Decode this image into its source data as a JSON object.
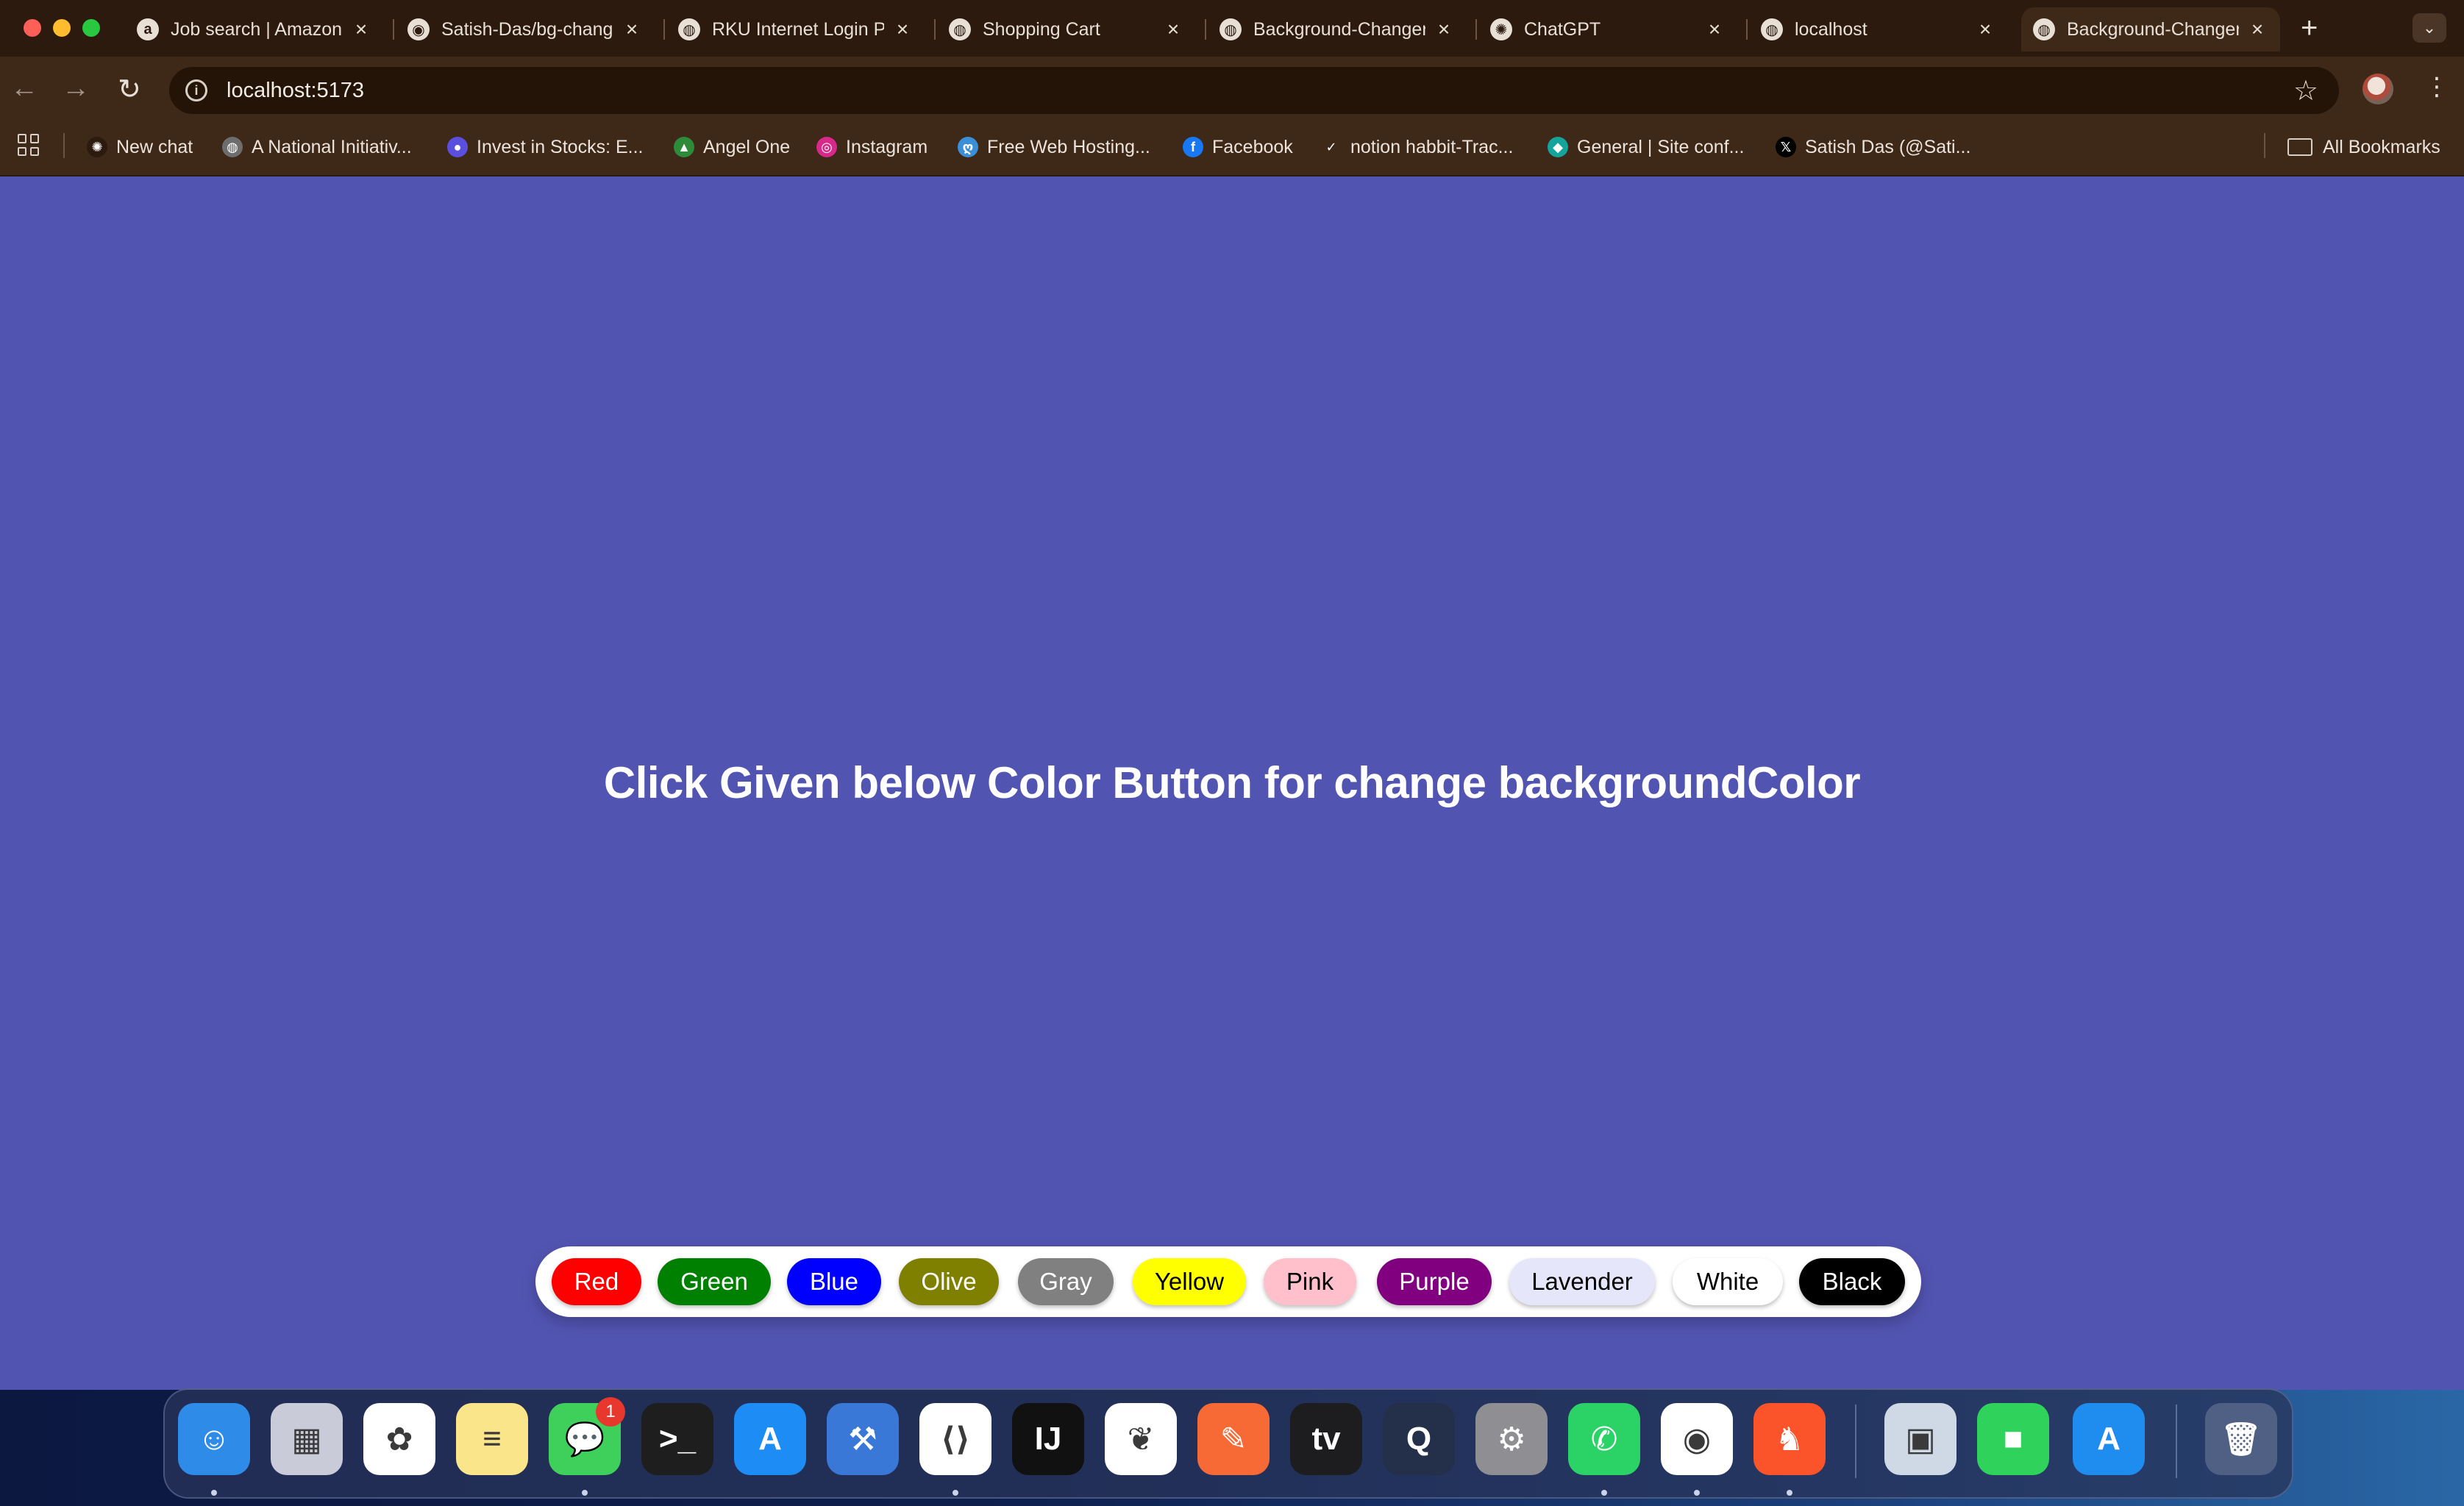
{
  "browser": {
    "tabs": [
      {
        "title": "Job search | Amazon",
        "icon": "amazon-icon",
        "fav": "a"
      },
      {
        "title": "Satish-Das/bg-changer",
        "icon": "github-icon",
        "fav": "◉"
      },
      {
        "title": "RKU Internet Login Page",
        "icon": "globe-icon",
        "fav": "◍"
      },
      {
        "title": "Shopping Cart",
        "icon": "globe-icon",
        "fav": "◍"
      },
      {
        "title": "Background-Changer",
        "icon": "globe-icon",
        "fav": "◍"
      },
      {
        "title": "ChatGPT",
        "icon": "chatgpt-icon",
        "fav": "✺"
      },
      {
        "title": "localhost",
        "icon": "globe-icon",
        "fav": "◍"
      },
      {
        "title": "Background-Changer",
        "icon": "globe-icon",
        "fav": "◍",
        "active": true
      }
    ],
    "close_glyph": "×",
    "new_tab_glyph": "+",
    "url": "localhost:5173",
    "bookmarks": [
      {
        "label": "New chat",
        "icon": "chatgpt-icon",
        "glyph": "✺",
        "color": "#2c1a0f"
      },
      {
        "label": "A National Initiativ...",
        "icon": "globe-icon",
        "glyph": "◍",
        "color": "#6d6d6d"
      },
      {
        "label": "Invest in Stocks: E...",
        "icon": "groww-icon",
        "glyph": "●",
        "color": "#5b4fe0"
      },
      {
        "label": "Angel One",
        "icon": "angel-one-icon",
        "glyph": "▲",
        "color": "#2e8b3a"
      },
      {
        "label": "Instagram",
        "icon": "instagram-icon",
        "glyph": "◎",
        "color": "#d6298a"
      },
      {
        "label": "Free Web Hosting...",
        "icon": "hosting-icon",
        "glyph": "ღ",
        "color": "#3a8fd6"
      },
      {
        "label": "Facebook",
        "icon": "facebook-icon",
        "glyph": "f",
        "color": "#1877f2"
      },
      {
        "label": "notion habbit-Trac...",
        "icon": "checkmark-icon",
        "glyph": "✓",
        "color": "#3e2818"
      },
      {
        "label": "General | Site conf...",
        "icon": "netlify-icon",
        "glyph": "◆",
        "color": "#15a49b"
      },
      {
        "label": "Satish Das (@Sati...",
        "icon": "x-icon",
        "glyph": "𝕏",
        "color": "#000000"
      }
    ],
    "all_bookmarks_label": "All Bookmarks"
  },
  "page": {
    "background": "#5254b2",
    "heading": "Click Given below Color Button for change backgroundColor",
    "buttons": [
      {
        "label": "Red",
        "bg": "#ff0000",
        "fg": "#ffffff"
      },
      {
        "label": "Green",
        "bg": "#008000",
        "fg": "#ffffff"
      },
      {
        "label": "Blue",
        "bg": "#0000ff",
        "fg": "#ffffff"
      },
      {
        "label": "Olive",
        "bg": "#808000",
        "fg": "#ffffff"
      },
      {
        "label": "Gray",
        "bg": "#808080",
        "fg": "#ffffff"
      },
      {
        "label": "Yellow",
        "bg": "#ffff00",
        "fg": "#000000"
      },
      {
        "label": "Pink",
        "bg": "#ffc0cb",
        "fg": "#000000"
      },
      {
        "label": "Purple",
        "bg": "#800080",
        "fg": "#ffffff"
      },
      {
        "label": "Lavender",
        "bg": "#e6e6fa",
        "fg": "#000000"
      },
      {
        "label": "White",
        "bg": "#ffffff",
        "fg": "#000000"
      },
      {
        "label": "Black",
        "bg": "#000000",
        "fg": "#ffffff"
      }
    ]
  },
  "dock": {
    "messages_badge": "1",
    "apps": [
      {
        "name": "finder-icon",
        "glyph": "☺",
        "bg": "#2f8be8",
        "dot": true
      },
      {
        "name": "launchpad-icon",
        "glyph": "▦",
        "bg": "#c9ccd8",
        "dot": false
      },
      {
        "name": "photos-icon",
        "glyph": "✿",
        "bg": "#ffffff",
        "dot": false
      },
      {
        "name": "notes-icon",
        "glyph": "≡",
        "bg": "#fbe58a",
        "dot": false
      },
      {
        "name": "messages-icon",
        "glyph": "💬",
        "bg": "#3ed05a",
        "dot": true
      },
      {
        "name": "terminal-icon",
        "glyph": ">_",
        "bg": "#1e1e1e",
        "dot": false
      },
      {
        "name": "app-store-icon",
        "glyph": "A",
        "bg": "#1e8cf5",
        "dot": false
      },
      {
        "name": "xcode-icon",
        "glyph": "⚒",
        "bg": "#3a78d8",
        "dot": false
      },
      {
        "name": "vscode-icon",
        "glyph": "⟨⟩",
        "bg": "#ffffff",
        "dot": true
      },
      {
        "name": "intellij-icon",
        "glyph": "IJ",
        "bg": "#111111",
        "dot": false
      },
      {
        "name": "mongodb-compass-icon",
        "glyph": "❦",
        "bg": "#ffffff",
        "dot": false
      },
      {
        "name": "postman-icon",
        "glyph": "✎",
        "bg": "#f76935",
        "dot": false
      },
      {
        "name": "apple-tv-icon",
        "glyph": "tv",
        "bg": "#1d1d1f",
        "dot": false
      },
      {
        "name": "quicktime-icon",
        "glyph": "Q",
        "bg": "#24304a",
        "dot": false
      },
      {
        "name": "system-settings-icon",
        "glyph": "⚙",
        "bg": "#8e8e93",
        "dot": false
      },
      {
        "name": "whatsapp-icon",
        "glyph": "✆",
        "bg": "#2bd366",
        "dot": true
      },
      {
        "name": "chrome-icon",
        "glyph": "◉",
        "bg": "#ffffff",
        "dot": true
      },
      {
        "name": "brave-icon",
        "glyph": "♞",
        "bg": "#fb542b",
        "dot": true
      },
      {
        "name": "preview-icon",
        "glyph": "▣",
        "bg": "#cfd9e6",
        "dot": false
      },
      {
        "name": "facetime-icon",
        "glyph": "■",
        "bg": "#2fd25a",
        "dot": false
      },
      {
        "name": "simulator-icon",
        "glyph": "A",
        "bg": "#1f8cf0",
        "dot": false
      },
      {
        "name": "trash-icon",
        "glyph": "🗑",
        "bg": "rgba(200,205,215,0.25)",
        "dot": false
      }
    ]
  }
}
